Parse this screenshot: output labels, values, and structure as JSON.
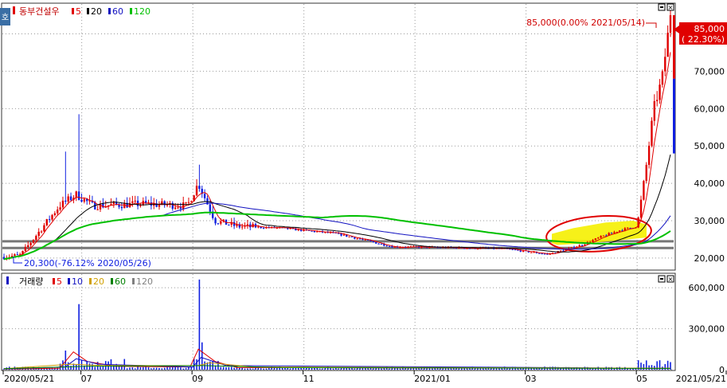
{
  "stock_name": "동부건설우",
  "price_legend": [
    {
      "label": "5",
      "color": "#e00000"
    },
    {
      "label": "20",
      "color": "#000000"
    },
    {
      "label": "60",
      "color": "#1010c0"
    },
    {
      "label": "120",
      "color": "#00c000"
    }
  ],
  "volume_title": "거래량",
  "volume_legend": [
    {
      "label": "5",
      "color": "#e00000"
    },
    {
      "label": "10",
      "color": "#1010c0"
    },
    {
      "label": "20",
      "color": "#d0a000"
    },
    {
      "label": "60",
      "color": "#008000"
    },
    {
      "label": "120",
      "color": "#808080"
    }
  ],
  "price_axis": {
    "ticks": [
      "80,000",
      "70,000",
      "60,000",
      "50,000",
      "40,000",
      "30,000",
      "20,000"
    ],
    "values": [
      80000,
      70000,
      60000,
      50000,
      40000,
      30000,
      20000
    ]
  },
  "volume_axis": {
    "ticks": [
      "600,000",
      "300,000",
      "0"
    ],
    "values": [
      600000,
      300000,
      0
    ]
  },
  "x_labels": [
    "2020/05/21",
    "07",
    "09",
    "11",
    "2021/01",
    "03",
    "05",
    "2021/05/21"
  ],
  "annot_high": "85,000(0.00% 2021/05/14)",
  "annot_low": "20,300(-76.12% 2020/05/26)",
  "current_price": "85,000",
  "current_change": "( 22.30%)",
  "side_tab": "호",
  "colors": {
    "up": "#e00000",
    "down": "#1020e0",
    "ma5": "#e00000",
    "ma20": "#000000",
    "ma60": "#1010c0",
    "ma120": "#00c000"
  },
  "chart_data": {
    "type": "candlestick",
    "x": [
      "2020/05/21",
      "2020/07",
      "2020/09",
      "2020/11",
      "2021/01",
      "2021/03",
      "2021/05",
      "2021/05/21"
    ],
    "price_ylim": [
      17000,
      88000
    ],
    "series": [
      {
        "name": "5",
        "values": [
          21000,
          34000,
          36000,
          28000,
          24000,
          22000,
          26000,
          70000
        ]
      },
      {
        "name": "20",
        "values": [
          20500,
          33000,
          34000,
          29000,
          24500,
          22500,
          25000,
          42000
        ]
      },
      {
        "name": "60",
        "values": [
          21000,
          29000,
          34000,
          30000,
          25000,
          23000,
          23500,
          29000
        ]
      },
      {
        "name": "120",
        "values": [
          18000,
          22000,
          27000,
          31000,
          28000,
          24500,
          23000,
          27000
        ]
      }
    ],
    "high": 85000,
    "low": 20300,
    "volume_ylim": [
      0,
      700000
    ],
    "volume_peaks": [
      {
        "date": "2020/07",
        "value": 480000
      },
      {
        "date": "2020/09",
        "value": 660000
      }
    ]
  }
}
